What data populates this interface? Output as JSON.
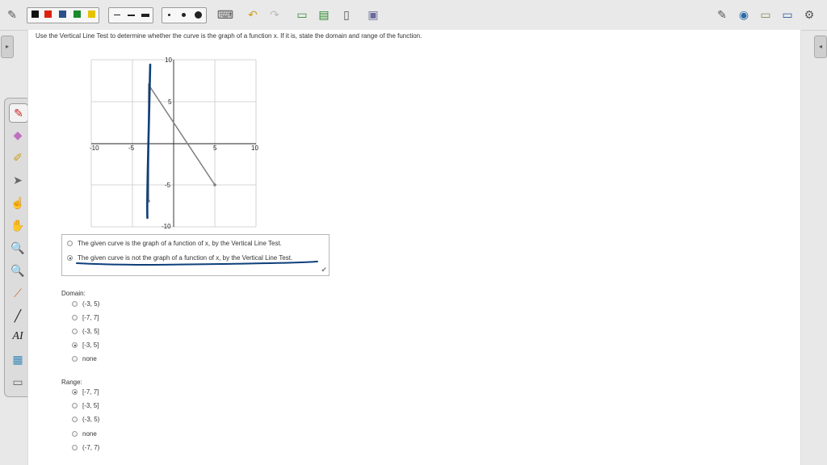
{
  "question": "Use the Vertical Line Test to determine whether the curve is the graph of a function x. If it is, state the domain and range of the function.",
  "graph": {
    "x_ticks": [
      "-10",
      "-5",
      "5",
      "10"
    ],
    "y_ticks": [
      "10",
      "5",
      "-5",
      "-10"
    ]
  },
  "choices": [
    {
      "text": "The given curve is the graph of a function of x, by the Vertical Line Test.",
      "selected": false
    },
    {
      "text": "The given curve is not the graph of a function of x, by the Vertical Line Test.",
      "selected": true
    }
  ],
  "domain": {
    "label": "Domain:",
    "options": [
      {
        "text": "(-3, 5)",
        "selected": false
      },
      {
        "text": "[-7, 7]",
        "selected": false
      },
      {
        "text": "(-3, 5]",
        "selected": false
      },
      {
        "text": "[-3, 5]",
        "selected": true
      },
      {
        "text": "none",
        "selected": false
      }
    ]
  },
  "range": {
    "label": "Range:",
    "options": [
      {
        "text": "[-7, 7]",
        "selected": true
      },
      {
        "text": "[-3, 5]",
        "selected": false
      },
      {
        "text": "(-3, 5)",
        "selected": false
      },
      {
        "text": "none",
        "selected": false
      },
      {
        "text": "(-7, 7)",
        "selected": false
      }
    ]
  },
  "colors": {
    "ink": "#0d3f7a",
    "curve": "#7f7f7f",
    "check": "#777777"
  },
  "toolbar_icons": [
    "pen-icon",
    "color-palette",
    "line-width-palette",
    "point-size-palette",
    "keyboard-icon",
    "undo-icon",
    "redo-icon",
    "add-page-icon",
    "export-icon",
    "blank-page-icon",
    "screen-icon",
    "edit-icon",
    "globe-icon",
    "folder-icon",
    "monitor-icon",
    "settings-icon"
  ]
}
